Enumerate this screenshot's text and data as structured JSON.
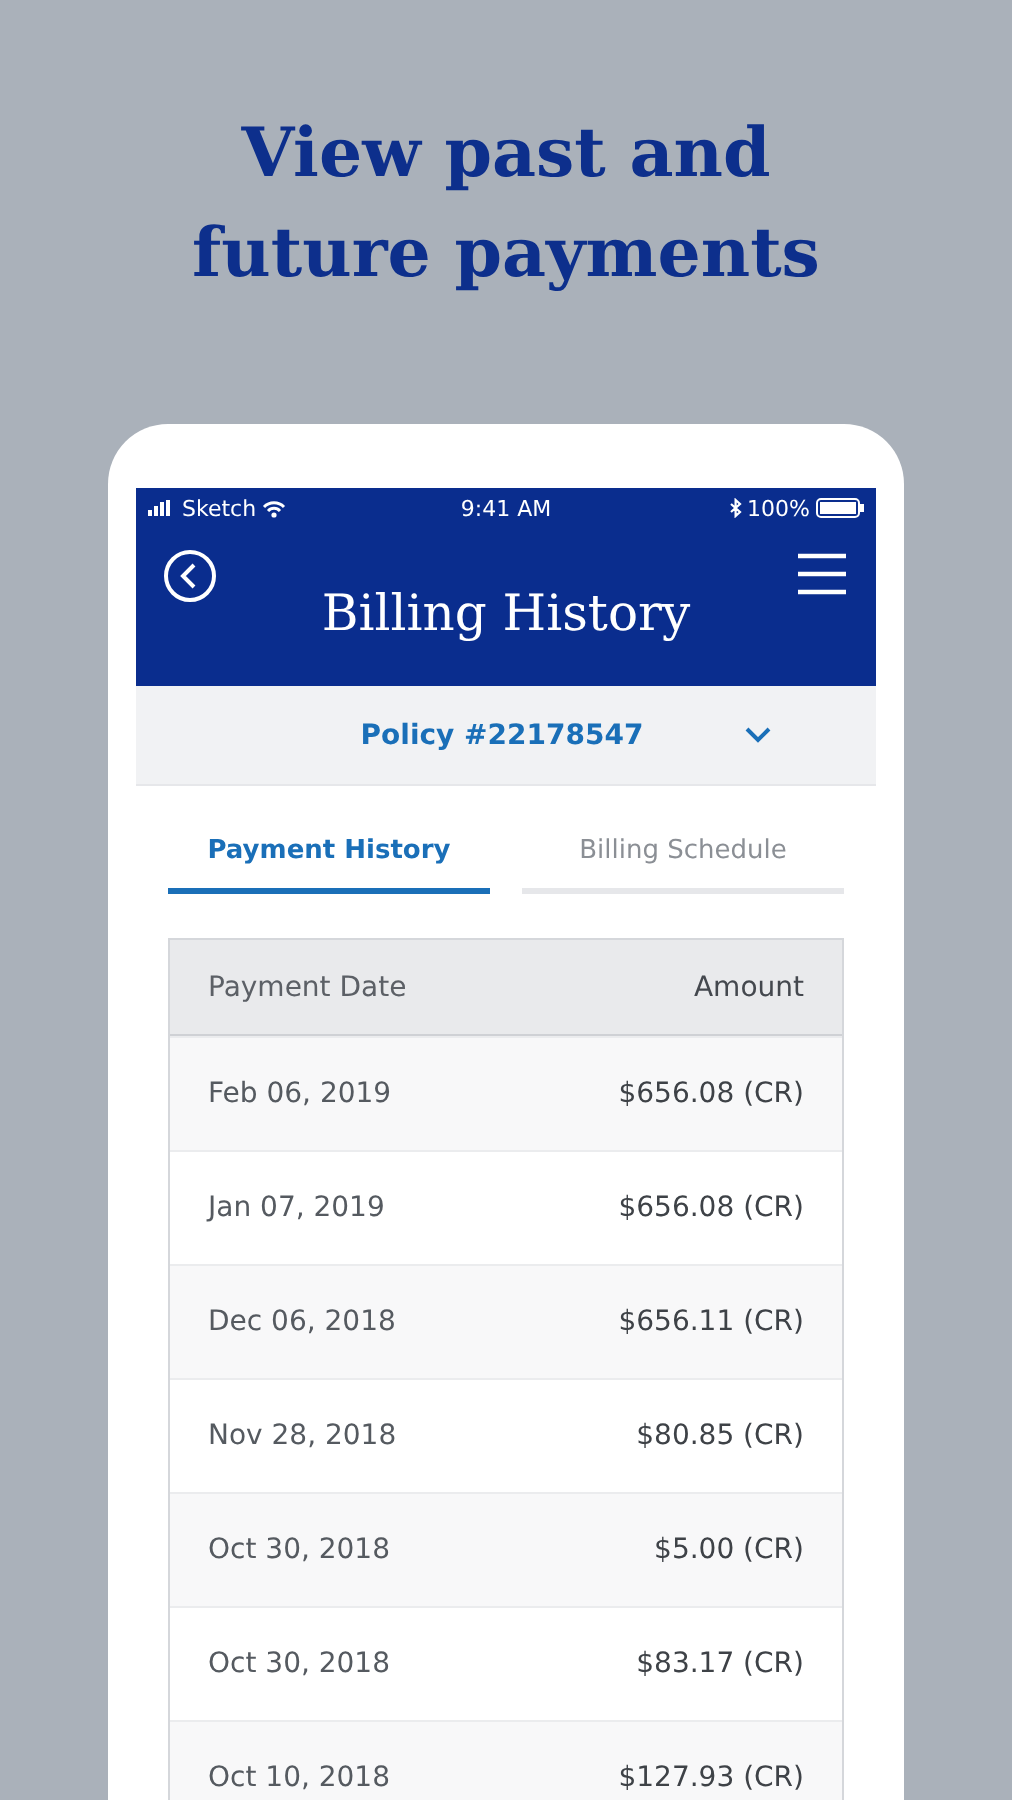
{
  "headline": "View past and future payments",
  "status_bar": {
    "carrier": "Sketch",
    "time": "9:41 AM",
    "battery": "100%"
  },
  "header": {
    "title": "Billing History"
  },
  "policy": {
    "label": "Policy #22178547"
  },
  "tabs": [
    {
      "label": "Payment History",
      "selected": true
    },
    {
      "label": "Billing Schedule",
      "selected": false
    }
  ],
  "table": {
    "columns": [
      "Payment Date",
      "Amount"
    ],
    "rows": [
      [
        "Feb 06, 2019",
        "$656.08 (CR)"
      ],
      [
        "Jan 07, 2019",
        "$656.08 (CR)"
      ],
      [
        "Dec 06, 2018",
        "$656.11 (CR)"
      ],
      [
        "Nov 28, 2018",
        "$80.85 (CR)"
      ],
      [
        "Oct 30, 2018",
        "$5.00 (CR)"
      ],
      [
        "Oct 30, 2018",
        "$83.17 (CR)"
      ],
      [
        "Oct 10, 2018",
        "$127.93 (CR)"
      ]
    ]
  }
}
